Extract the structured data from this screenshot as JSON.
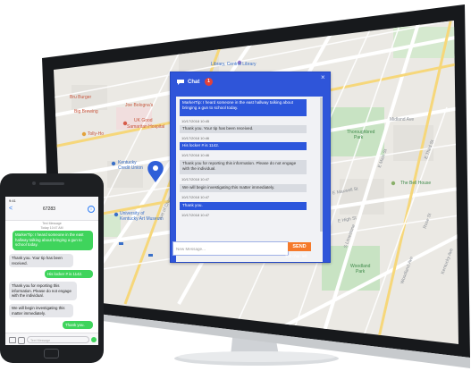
{
  "map": {
    "labels": {
      "library": "Library, Central Library",
      "bru_burger": "Bru Burger",
      "big_brewing": "Big Brewing",
      "joe_bologna": "Joe Bologna's",
      "uk_good_samaritan": "UK Good",
      "samaritan_hospital": "Samaritan Hospital",
      "tolly_ho": "Tolly-Ho",
      "kentucky_federal": "Kentucky",
      "credit_union": "Credit Union",
      "university": "University of",
      "art_museum": "Kentucky Art Museum",
      "thoroughbred_park": "Thoroughbred",
      "park_word": "Park",
      "midland_ave": "Midland Ave",
      "bell_house": "The Bell House",
      "woodland_park": "Woodland",
      "woodland_park_word": "Park",
      "e_main": "E Main St",
      "e_third": "E Third St",
      "e_high": "E High St",
      "rose_st": "Rose St",
      "ave_of_champ": "Ave of Champions",
      "s_limestone": "S Limestone",
      "e_maxwell": "E Maxwell St",
      "woodland_ave": "Woodland Ave",
      "kentucky_ave": "Kentucky Ave"
    }
  },
  "chat": {
    "title": "Chat",
    "badge": "1",
    "close": "×",
    "messages": [
      {
        "text": "MarkerTip: I heard someone in the east hallway talking about bringing a gun to school today.",
        "kind": "in",
        "stamp": "10/17/2018 10:45"
      },
      {
        "text": "Thank you. Your tip has been received.",
        "kind": "out",
        "stamp": "10/17/2018 10:46"
      },
      {
        "text": "His locker # is 1142.",
        "kind": "in",
        "stamp": "10/17/2018 10:46"
      },
      {
        "text": "Thank you for reporting this information. Please do not engage with the individual.",
        "kind": "out",
        "stamp": "10/17/2018 10:47"
      },
      {
        "text": "We will begin investigating this matter immediately.",
        "kind": "out",
        "stamp": "10/17/2018 10:47"
      },
      {
        "text": "Thank you.",
        "kind": "in",
        "stamp": "10/17/2018 10:47"
      }
    ],
    "input_placeholder": "New Message...",
    "send_label": "SEND",
    "char_left": "160 char. left"
  },
  "phone": {
    "time": "9:41",
    "back": "<",
    "contact": "67283",
    "info": "i",
    "header_sub": "Text Message",
    "header_date": "Today 10:47 AM",
    "messages": [
      {
        "text": "MarkerTip: I heard someone in the east hallway talking about bringing a gun to school today.",
        "kind": "green"
      },
      {
        "text": "Thank you. Your tip has been received.",
        "kind": "grey"
      },
      {
        "text": "His locker # is 1142.",
        "kind": "green"
      },
      {
        "text": "Thank you for reporting this information. Please do not engage with the individual.",
        "kind": "grey"
      },
      {
        "text": "We will begin investigating this matter immediately.",
        "kind": "grey"
      },
      {
        "text": "Thank you.",
        "kind": "green"
      }
    ],
    "input_placeholder": "Text Message"
  }
}
